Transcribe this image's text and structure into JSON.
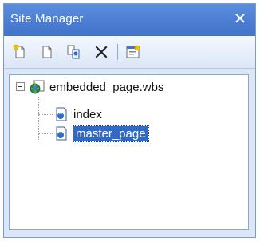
{
  "window": {
    "title": "Site Manager",
    "close_label": "✕"
  },
  "toolbar": {
    "buttons": [
      {
        "name": "new-page-icon"
      },
      {
        "name": "new-file-icon"
      },
      {
        "name": "copy-page-icon"
      },
      {
        "name": "delete-icon"
      },
      {
        "name": "properties-icon"
      }
    ]
  },
  "tree": {
    "root": {
      "label": "embedded_page.wbs",
      "icon": "website-globe-icon",
      "expanded": true
    },
    "children": [
      {
        "label": "index",
        "icon": "page-icon",
        "selected": false
      },
      {
        "label": "master_page",
        "icon": "page-icon",
        "selected": true
      }
    ]
  },
  "colors": {
    "titlebar": "#4f82d6",
    "panel": "#dbe6f7",
    "selection": "#316ac5"
  }
}
